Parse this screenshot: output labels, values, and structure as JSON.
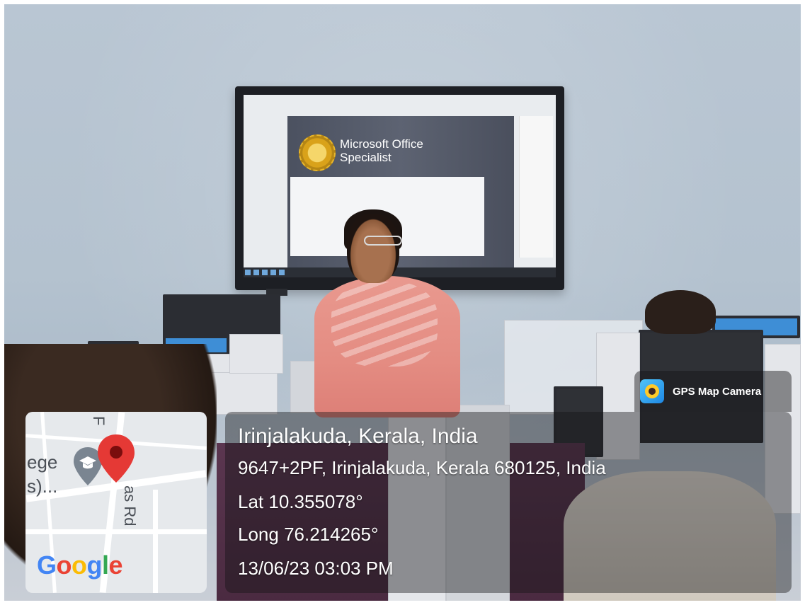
{
  "slide": {
    "title_line1": "Microsoft Office",
    "title_line2": "Specialist"
  },
  "stamp": {
    "app_label": "GPS Map Camera",
    "place_name": "Irinjalakuda, Kerala, India",
    "address": "9647+2PF, Irinjalakuda, Kerala 680125, India",
    "latitude": "Lat 10.355078°",
    "longitude": "Long 76.214265°",
    "datetime": "13/06/23 03:03 PM"
  },
  "map": {
    "label_fragment_1": "ege",
    "label_fragment_2": "s)...",
    "road_fragment_1": "F",
    "road_fragment_2": "as Rd",
    "logo_text": "Google",
    "logo_colors": [
      "#4285F4",
      "#EA4335",
      "#FBBC05",
      "#4285F4",
      "#34A853",
      "#EA4335"
    ],
    "pin_color": "#E53935"
  }
}
